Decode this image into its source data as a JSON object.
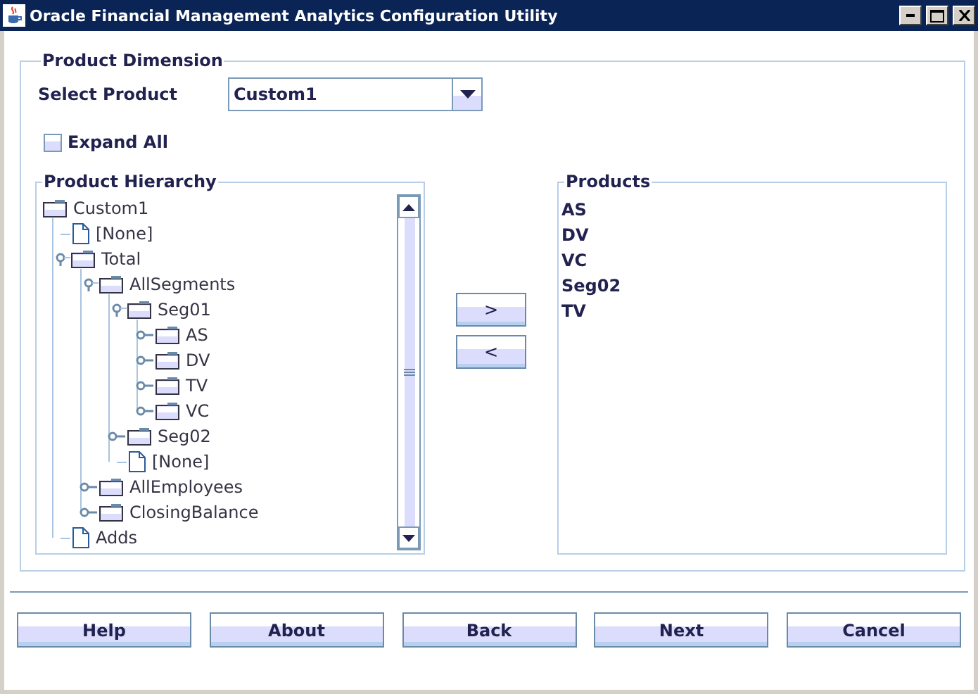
{
  "window": {
    "title": "Oracle Financial Management Analytics Configuration Utility"
  },
  "dimension_group": {
    "title": "Product Dimension"
  },
  "select_product": {
    "label": "Select Product",
    "value": "Custom1"
  },
  "expand_all": {
    "label": "Expand All",
    "checked": false
  },
  "hierarchy": {
    "title": "Product Hierarchy",
    "tree": [
      {
        "label": "Custom1",
        "kind": "folder",
        "children": [
          {
            "label": "[None]",
            "kind": "leaf"
          },
          {
            "label": "Total",
            "kind": "folder",
            "expanded": true,
            "children": [
              {
                "label": "AllSegments",
                "kind": "folder",
                "expanded": true,
                "children": [
                  {
                    "label": "Seg01",
                    "kind": "folder",
                    "expanded": true,
                    "children": [
                      {
                        "label": "AS",
                        "kind": "folder",
                        "expanded": false
                      },
                      {
                        "label": "DV",
                        "kind": "folder",
                        "expanded": false
                      },
                      {
                        "label": "TV",
                        "kind": "folder",
                        "expanded": false
                      },
                      {
                        "label": "VC",
                        "kind": "folder",
                        "expanded": false
                      }
                    ]
                  },
                  {
                    "label": "Seg02",
                    "kind": "folder",
                    "expanded": false
                  },
                  {
                    "label": "[None]",
                    "kind": "leaf"
                  }
                ]
              },
              {
                "label": "AllEmployees",
                "kind": "folder",
                "expanded": false
              },
              {
                "label": "ClosingBalance",
                "kind": "folder",
                "expanded": false
              }
            ]
          },
          {
            "label": "Adds",
            "kind": "leaf"
          }
        ]
      }
    ]
  },
  "move_buttons": [
    ">",
    "<"
  ],
  "products": {
    "title": "Products",
    "items": [
      "AS",
      "DV",
      "VC",
      "Seg02",
      "TV"
    ]
  },
  "buttons": [
    "Help",
    "About",
    "Back",
    "Next",
    "Cancel"
  ]
}
